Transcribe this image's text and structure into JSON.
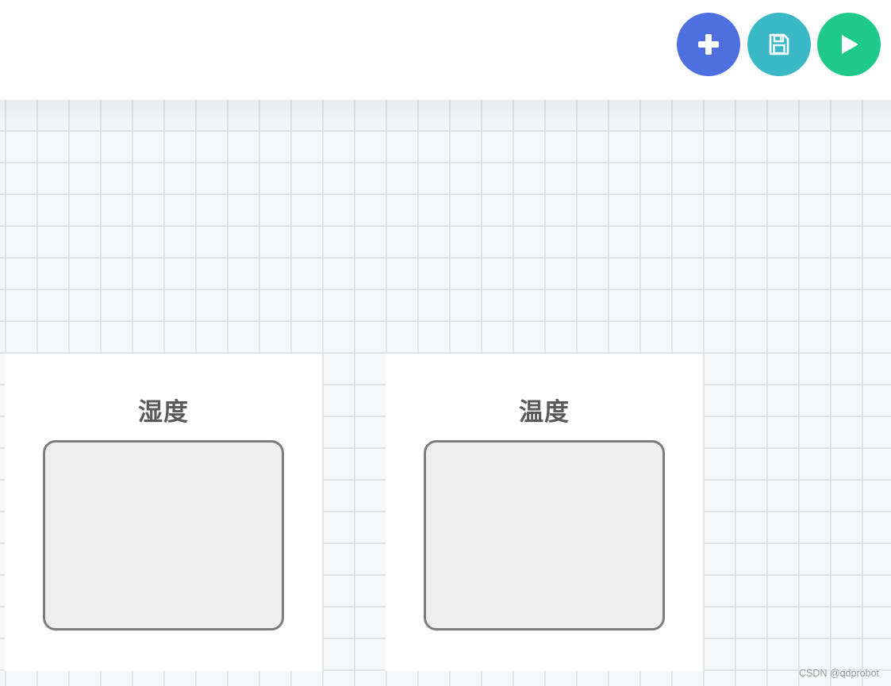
{
  "toolbar": {
    "add_icon": "plus-icon",
    "save_icon": "floppy-disk-icon",
    "run_icon": "play-icon",
    "colors": {
      "add": "#4e6fdf",
      "save": "#3ab8c6",
      "run": "#1ec98a"
    }
  },
  "canvas": {
    "nodes": [
      {
        "title": "湿度"
      },
      {
        "title": "温度"
      }
    ]
  },
  "watermark": "CSDN @qdprobot"
}
